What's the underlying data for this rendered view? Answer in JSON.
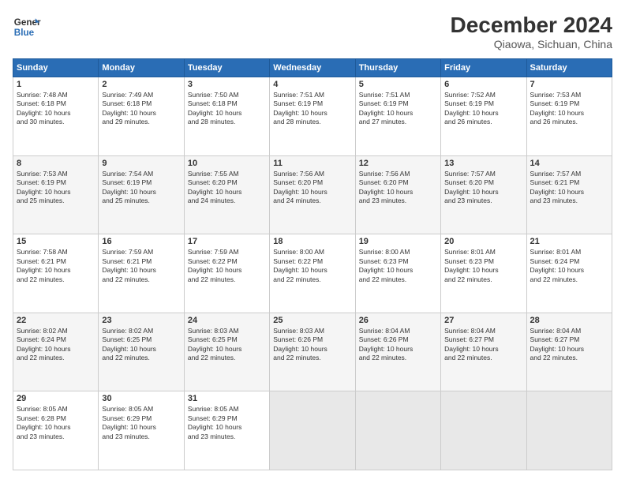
{
  "header": {
    "logo_line1": "General",
    "logo_line2": "Blue",
    "month": "December 2024",
    "location": "Qiaowa, Sichuan, China"
  },
  "weekdays": [
    "Sunday",
    "Monday",
    "Tuesday",
    "Wednesday",
    "Thursday",
    "Friday",
    "Saturday"
  ],
  "weeks": [
    [
      {
        "day": "1",
        "info": "Sunrise: 7:48 AM\nSunset: 6:18 PM\nDaylight: 10 hours\nand 30 minutes."
      },
      {
        "day": "2",
        "info": "Sunrise: 7:49 AM\nSunset: 6:18 PM\nDaylight: 10 hours\nand 29 minutes."
      },
      {
        "day": "3",
        "info": "Sunrise: 7:50 AM\nSunset: 6:18 PM\nDaylight: 10 hours\nand 28 minutes."
      },
      {
        "day": "4",
        "info": "Sunrise: 7:51 AM\nSunset: 6:19 PM\nDaylight: 10 hours\nand 28 minutes."
      },
      {
        "day": "5",
        "info": "Sunrise: 7:51 AM\nSunset: 6:19 PM\nDaylight: 10 hours\nand 27 minutes."
      },
      {
        "day": "6",
        "info": "Sunrise: 7:52 AM\nSunset: 6:19 PM\nDaylight: 10 hours\nand 26 minutes."
      },
      {
        "day": "7",
        "info": "Sunrise: 7:53 AM\nSunset: 6:19 PM\nDaylight: 10 hours\nand 26 minutes."
      }
    ],
    [
      {
        "day": "8",
        "info": "Sunrise: 7:53 AM\nSunset: 6:19 PM\nDaylight: 10 hours\nand 25 minutes."
      },
      {
        "day": "9",
        "info": "Sunrise: 7:54 AM\nSunset: 6:19 PM\nDaylight: 10 hours\nand 25 minutes."
      },
      {
        "day": "10",
        "info": "Sunrise: 7:55 AM\nSunset: 6:20 PM\nDaylight: 10 hours\nand 24 minutes."
      },
      {
        "day": "11",
        "info": "Sunrise: 7:56 AM\nSunset: 6:20 PM\nDaylight: 10 hours\nand 24 minutes."
      },
      {
        "day": "12",
        "info": "Sunrise: 7:56 AM\nSunset: 6:20 PM\nDaylight: 10 hours\nand 23 minutes."
      },
      {
        "day": "13",
        "info": "Sunrise: 7:57 AM\nSunset: 6:20 PM\nDaylight: 10 hours\nand 23 minutes."
      },
      {
        "day": "14",
        "info": "Sunrise: 7:57 AM\nSunset: 6:21 PM\nDaylight: 10 hours\nand 23 minutes."
      }
    ],
    [
      {
        "day": "15",
        "info": "Sunrise: 7:58 AM\nSunset: 6:21 PM\nDaylight: 10 hours\nand 22 minutes."
      },
      {
        "day": "16",
        "info": "Sunrise: 7:59 AM\nSunset: 6:21 PM\nDaylight: 10 hours\nand 22 minutes."
      },
      {
        "day": "17",
        "info": "Sunrise: 7:59 AM\nSunset: 6:22 PM\nDaylight: 10 hours\nand 22 minutes."
      },
      {
        "day": "18",
        "info": "Sunrise: 8:00 AM\nSunset: 6:22 PM\nDaylight: 10 hours\nand 22 minutes."
      },
      {
        "day": "19",
        "info": "Sunrise: 8:00 AM\nSunset: 6:23 PM\nDaylight: 10 hours\nand 22 minutes."
      },
      {
        "day": "20",
        "info": "Sunrise: 8:01 AM\nSunset: 6:23 PM\nDaylight: 10 hours\nand 22 minutes."
      },
      {
        "day": "21",
        "info": "Sunrise: 8:01 AM\nSunset: 6:24 PM\nDaylight: 10 hours\nand 22 minutes."
      }
    ],
    [
      {
        "day": "22",
        "info": "Sunrise: 8:02 AM\nSunset: 6:24 PM\nDaylight: 10 hours\nand 22 minutes."
      },
      {
        "day": "23",
        "info": "Sunrise: 8:02 AM\nSunset: 6:25 PM\nDaylight: 10 hours\nand 22 minutes."
      },
      {
        "day": "24",
        "info": "Sunrise: 8:03 AM\nSunset: 6:25 PM\nDaylight: 10 hours\nand 22 minutes."
      },
      {
        "day": "25",
        "info": "Sunrise: 8:03 AM\nSunset: 6:26 PM\nDaylight: 10 hours\nand 22 minutes."
      },
      {
        "day": "26",
        "info": "Sunrise: 8:04 AM\nSunset: 6:26 PM\nDaylight: 10 hours\nand 22 minutes."
      },
      {
        "day": "27",
        "info": "Sunrise: 8:04 AM\nSunset: 6:27 PM\nDaylight: 10 hours\nand 22 minutes."
      },
      {
        "day": "28",
        "info": "Sunrise: 8:04 AM\nSunset: 6:27 PM\nDaylight: 10 hours\nand 22 minutes."
      }
    ],
    [
      {
        "day": "29",
        "info": "Sunrise: 8:05 AM\nSunset: 6:28 PM\nDaylight: 10 hours\nand 23 minutes."
      },
      {
        "day": "30",
        "info": "Sunrise: 8:05 AM\nSunset: 6:29 PM\nDaylight: 10 hours\nand 23 minutes."
      },
      {
        "day": "31",
        "info": "Sunrise: 8:05 AM\nSunset: 6:29 PM\nDaylight: 10 hours\nand 23 minutes."
      },
      {
        "day": "",
        "info": ""
      },
      {
        "day": "",
        "info": ""
      },
      {
        "day": "",
        "info": ""
      },
      {
        "day": "",
        "info": ""
      }
    ]
  ]
}
